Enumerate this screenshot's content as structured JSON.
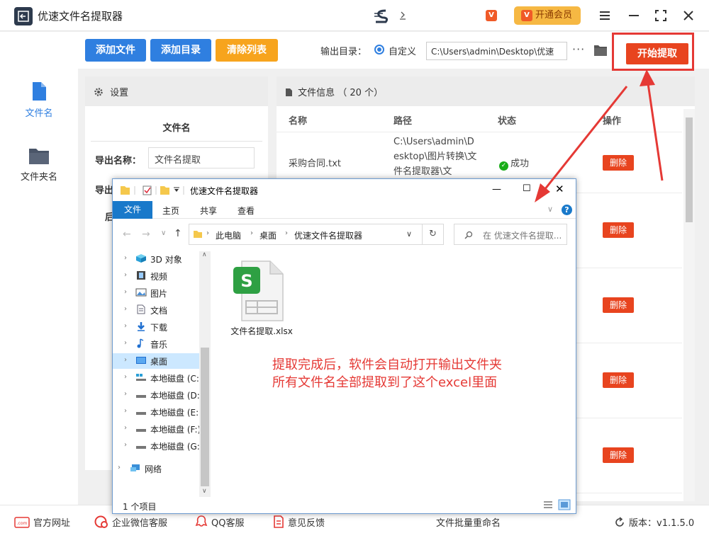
{
  "app": {
    "title": "优速文件名提取器",
    "vip_label": "开通会员",
    "vip_badge": "V"
  },
  "leftnav": {
    "items": [
      {
        "label": "文件名"
      },
      {
        "label": "文件夹名"
      }
    ]
  },
  "toolbar": {
    "add_file": "添加文件",
    "add_dir": "添加目录",
    "clear_list": "清除列表",
    "output_label": "输出目录：",
    "custom_label": "自定义",
    "output_path": "C:\\Users\\admin\\Desktop\\优速",
    "more": "···",
    "start": "开始提取"
  },
  "settings": {
    "title": "设置",
    "section": "文件名",
    "export_name_label": "导出名称：",
    "export_name_value": "文件名提取",
    "export_label2_partial": "导出",
    "label3_partial": "后"
  },
  "fileinfo": {
    "title": "文件信息 （ 20 个）",
    "columns": [
      "名称",
      "路径",
      "状态",
      "操作"
    ],
    "rows": [
      {
        "name": "采购合同.txt",
        "path": "C:\\Users\\admin\\Desktop\\图片转换\\文件名提取器\\文",
        "status": "成功",
        "action": "删除"
      },
      {
        "action": "删除"
      },
      {
        "action": "删除"
      },
      {
        "action": "删除"
      },
      {
        "action": "删除"
      }
    ]
  },
  "footer": {
    "website": "官方网址",
    "wechat": "企业微信客服",
    "qq": "QQ客服",
    "feedback": "意见反馈",
    "rename": "文件批量重命名",
    "version": "版本：v1.1.5.0"
  },
  "explorer": {
    "title": "优速文件名提取器",
    "tabs": [
      "文件",
      "主页",
      "共享",
      "查看"
    ],
    "crumbs": [
      "此电脑",
      "桌面",
      "优速文件名提取器"
    ],
    "search_placeholder": "在 优速文件名提取...",
    "tree": [
      {
        "label": "3D 对象"
      },
      {
        "label": "视频"
      },
      {
        "label": "图片"
      },
      {
        "label": "文档"
      },
      {
        "label": "下载"
      },
      {
        "label": "音乐"
      },
      {
        "label": "桌面"
      },
      {
        "label": "本地磁盘 (C:"
      },
      {
        "label": "本地磁盘 (D:"
      },
      {
        "label": "本地磁盘 (E:"
      },
      {
        "label": "本地磁盘 (F:)"
      },
      {
        "label": "本地磁盘 (G:"
      },
      {
        "label": "网络"
      }
    ],
    "file_name": "文件名提取.xlsx",
    "annotation_line1": "提取完成后，软件会自动打开输出文件夹",
    "annotation_line2": "所有文件名全部提取到了这个excel里面",
    "status": "1 个项目"
  },
  "colors": {
    "blue_btn": "#2f7fe0",
    "orange_btn": "#f7a41d",
    "red_btn": "#e8441f",
    "annot_red": "#e53935",
    "explorer_tab": "#1979ca"
  }
}
